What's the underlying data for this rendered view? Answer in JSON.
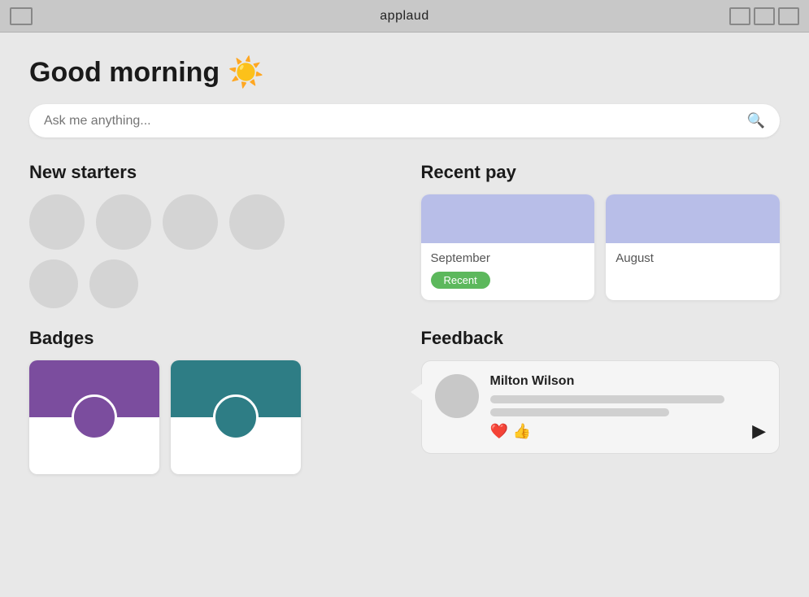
{
  "titleBar": {
    "title": "applaud"
  },
  "greeting": {
    "text": "Good morning",
    "emoji": "☀️"
  },
  "search": {
    "placeholder": "Ask me anything..."
  },
  "newStarters": {
    "label": "New starters",
    "avatarRows": [
      [
        1,
        2,
        3,
        4
      ],
      [
        1,
        2
      ]
    ]
  },
  "recentPay": {
    "label": "Recent pay",
    "cards": [
      {
        "month": "September",
        "badge": "Recent"
      },
      {
        "month": "August",
        "badge": ""
      }
    ]
  },
  "badges": {
    "label": "Badges",
    "items": [
      {
        "color": "purple"
      },
      {
        "color": "teal"
      }
    ]
  },
  "feedback": {
    "label": "Feedback",
    "card": {
      "name": "Milton Wilson"
    }
  },
  "reactions": {
    "heart": "❤️",
    "thumbsUp": "👍"
  }
}
